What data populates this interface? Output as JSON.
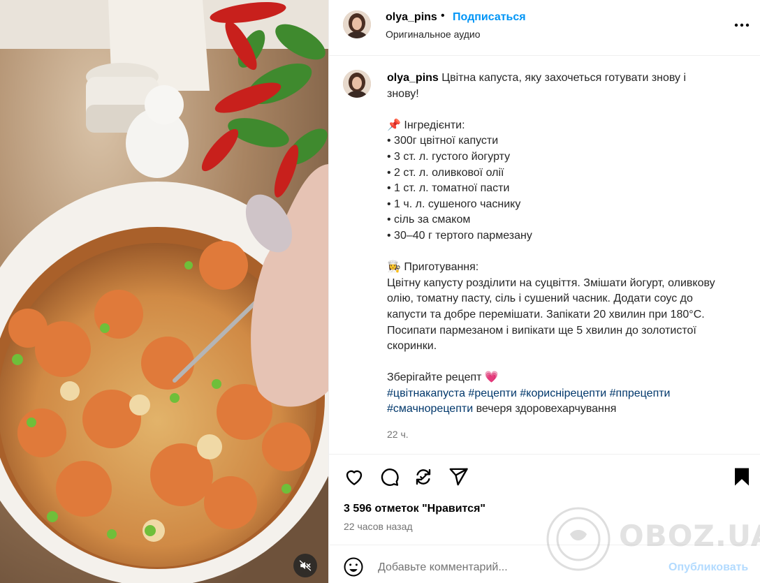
{
  "post": {
    "username": "olya_pins",
    "follow_label": "Подписаться",
    "separator": "•",
    "audio": "Оригинальное аудио"
  },
  "caption": {
    "username": "olya_pins",
    "title": "Цвітна капуста, яку захочеться готувати знову і знову!",
    "ingredients_heading": "📌 Інгредієнти:",
    "ingredients": [
      "• 300г цвітної капусти",
      "• 3 ст. л. густого йогурту",
      "• 2 ст. л. оливкової олії",
      "• 1 ст. л. томатної пасти",
      "• 1 ч. л. сушеного часнику",
      "• сіль за смаком",
      "• 30–40 г тертого пармезану"
    ],
    "method_heading": "👩‍🍳 Приготування:",
    "method": "Цвітну капусту розділити на суцвіття. Змішати йогурт, оливкову олію, томатну пасту, сіль і сушений часник. Додати соус до капусти та добре перемішати. Запікати 20 хвилин при 180°C. Посипати пармезаном і випікати ще 5 хвилин до золотистої скоринки.",
    "save_line": "Зберігайте рецепт 💗",
    "hashtags": [
      "#цвітнакапуста",
      "#рецепти",
      "#кориснірецепти",
      "#ппрецепти",
      "#смачнорецепти"
    ],
    "trailing_text": "вечеря здоровехарчування",
    "time": "22 ч."
  },
  "actions": {
    "likes": "3 596 отметок \"Нравится\"",
    "ago": "22 часов назад"
  },
  "comment": {
    "placeholder": "Добавьте комментарий...",
    "publish_label": "Опубликовать"
  },
  "watermark": {
    "text": "OBOZ.UA"
  },
  "icons": {
    "like": "heart-icon",
    "comment": "comment-icon",
    "share": "repost-icon",
    "send": "send-icon",
    "save": "bookmark-icon",
    "more": "more-icon",
    "mute": "speaker-muted-icon",
    "emoji": "emoji-icon"
  },
  "colors": {
    "link_blue": "#0095f6",
    "hashtag": "#00376b",
    "publish_disabled": "#b3dbff",
    "muted_text": "#737373"
  }
}
